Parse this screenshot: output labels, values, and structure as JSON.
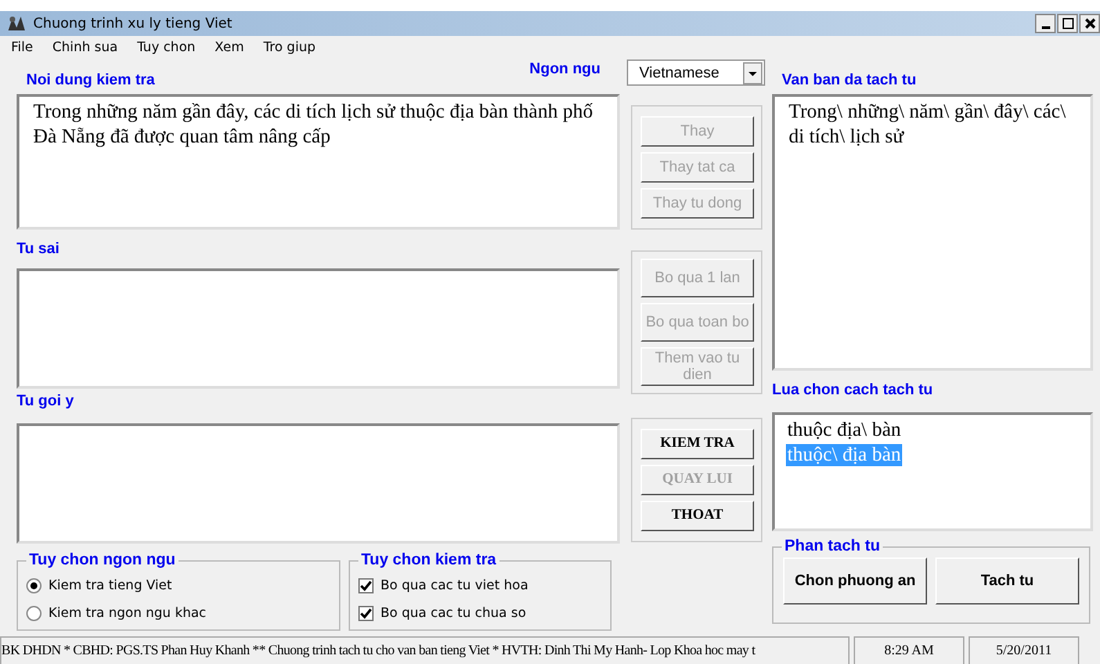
{
  "window": {
    "title": "Chuong trinh xu ly tieng Viet"
  },
  "menu": [
    "File",
    "Chinh sua",
    "Tuy chon",
    "Xem",
    "Tro giup"
  ],
  "check_content": {
    "label": "Noi dung kiem tra",
    "text": "Trong những năm gần đây, các di tích lịch sử thuộc địa bàn thành phố Đà Nẵng đã được quan tâm nâng cấp"
  },
  "language": {
    "label": "Ngon ngu",
    "value": "Vietnamese"
  },
  "wrong_words": {
    "label": "Tu sai"
  },
  "suggestions": {
    "label": "Tu goi y"
  },
  "replace_buttons": [
    {
      "label": "Thay",
      "disabled": true
    },
    {
      "label": "Thay tat ca",
      "disabled": true
    },
    {
      "label": "Thay tu dong",
      "disabled": true
    }
  ],
  "skip_buttons": [
    {
      "label": "Bo qua 1 lan",
      "disabled": true
    },
    {
      "label": "Bo qua toan bo",
      "disabled": true
    },
    {
      "label": "Them vao tu dien",
      "disabled": true
    }
  ],
  "action_buttons": [
    {
      "label": "KIEM TRA",
      "disabled": false
    },
    {
      "label": "QUAY LUI",
      "disabled": true
    },
    {
      "label": "THOAT",
      "disabled": false
    }
  ],
  "segmented": {
    "label": "Van ban da tach tu",
    "text": "Trong\\ những\\ năm\\ gần\\ đây\\ các\\ di tích\\ lịch sử"
  },
  "segmentation_choices": {
    "label": "Lua chon cach tach tu",
    "options": [
      {
        "text": "thuộc địa\\ bàn",
        "selected": false
      },
      {
        "text": "thuộc\\ địa bàn",
        "selected": true
      }
    ]
  },
  "language_options": {
    "title": "Tuy chon ngon ngu",
    "options": [
      {
        "label": "Kiem tra tieng Viet",
        "selected": true
      },
      {
        "label": "Kiem tra ngon ngu khac",
        "selected": false
      }
    ]
  },
  "check_options": {
    "title": "Tuy chon kiem tra",
    "options": [
      {
        "label": "Bo qua cac tu viet hoa",
        "checked": true
      },
      {
        "label": "Bo qua cac tu chua so",
        "checked": true
      }
    ]
  },
  "split_group": {
    "title": "Phan tach tu",
    "buttons": [
      "Chon phuong an",
      "Tach tu"
    ]
  },
  "status_bar": {
    "message": "BK DHDN * CBHD: PGS.TS Phan Huy Khanh ** Chuong trinh tach tu cho van ban tieng Viet * HVTH: Dinh Thi My Hanh- Lop Khoa hoc may t",
    "time": "8:29 AM",
    "date": "5/20/2011"
  }
}
